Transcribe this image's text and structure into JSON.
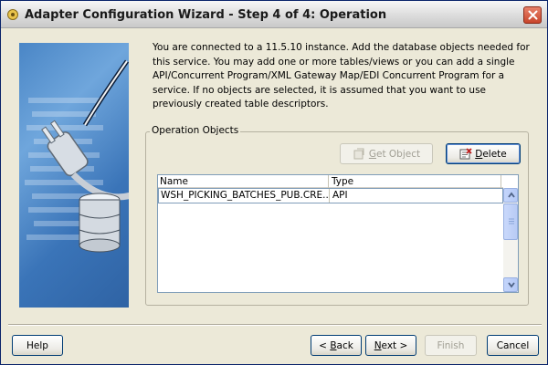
{
  "window": {
    "title": "Adapter Configuration Wizard - Step 4 of 4: Operation",
    "title_icon": "wizard-icon",
    "close_icon": "close-icon"
  },
  "side_image": {
    "icon": "plug-database-icon"
  },
  "intro": {
    "text": "You are connected to a 11.5.10 instance. Add the database objects needed for this service. You may add one or more tables/views or you can add a single API/Concurrent Program/XML Gateway Map/EDI Concurrent Program for a service. If no objects are selected, it is assumed that you want to use previously created table descriptors."
  },
  "operation_objects": {
    "label": "Operation Objects",
    "get_object": {
      "label": "Get Object",
      "mnemonic": "G",
      "rest": "et Object",
      "icon": "get-object-icon",
      "enabled": false
    },
    "delete": {
      "label": "Delete",
      "mnemonic": "D",
      "rest": "elete",
      "icon": "delete-icon",
      "enabled": true
    },
    "table": {
      "columns": [
        "Name",
        "Type"
      ],
      "rows": [
        {
          "name": "WSH_PICKING_BATCHES_PUB.CRE...",
          "type": "API"
        }
      ]
    }
  },
  "footer": {
    "help": {
      "label": "Help"
    },
    "back": {
      "label": "< Back",
      "prefix": "< ",
      "mnemonic": "B",
      "rest": "ack"
    },
    "next": {
      "label": "Next >",
      "mnemonic": "N",
      "rest": "ext >"
    },
    "finish": {
      "label": "Finish",
      "enabled": false
    },
    "cancel": {
      "label": "Cancel"
    }
  }
}
